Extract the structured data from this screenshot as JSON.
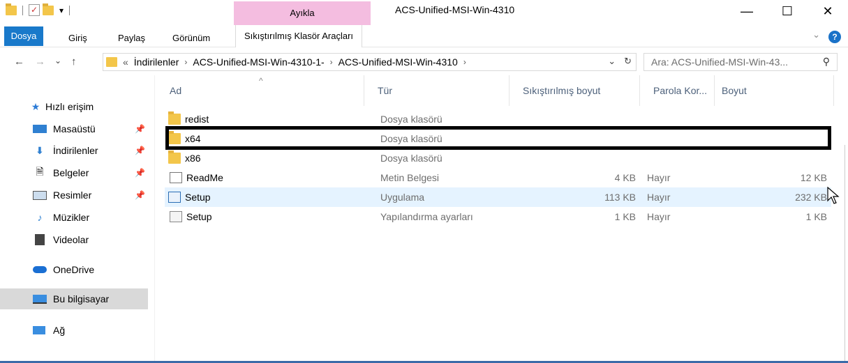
{
  "window": {
    "title": "ACS-Unified-MSI-Win-4310",
    "context_tab_header": "Ayıkla",
    "controls": {
      "minimize": "—",
      "maximize": "☐",
      "close": "✕"
    }
  },
  "ribbon": {
    "tabs": [
      {
        "label": "Dosya"
      },
      {
        "label": "Giriş"
      },
      {
        "label": "Paylaş"
      },
      {
        "label": "Görünüm"
      },
      {
        "label": "Sıkıştırılmış Klasör Araçları"
      }
    ],
    "help": "?",
    "expand": "⌄"
  },
  "nav": {
    "back": "←",
    "forward": "→",
    "recent": "⌄",
    "up": "↑",
    "breadcrumb": [
      "«",
      "İndirilenler",
      "ACS-Unified-MSI-Win-4310-1-",
      "ACS-Unified-MSI-Win-4310"
    ],
    "address_dropdown": "⌄",
    "refresh": "↻",
    "search_placeholder": "Ara: ACS-Unified-MSI-Win-43..."
  },
  "sidebar": {
    "items": [
      {
        "label": "Hızlı erişim",
        "icon": "star-icon"
      },
      {
        "label": "Masaüstü",
        "icon": "desktop-icon",
        "pinned": true
      },
      {
        "label": "İndirilenler",
        "icon": "download-icon",
        "pinned": true
      },
      {
        "label": "Belgeler",
        "icon": "documents-icon",
        "pinned": true
      },
      {
        "label": "Resimler",
        "icon": "pictures-icon",
        "pinned": true
      },
      {
        "label": "Müzikler",
        "icon": "music-icon"
      },
      {
        "label": "Videolar",
        "icon": "videos-icon"
      },
      {
        "label": "OneDrive",
        "icon": "cloud-icon"
      },
      {
        "label": "Bu bilgisayar",
        "icon": "computer-icon",
        "selected": true
      },
      {
        "label": "Ağ",
        "icon": "network-icon"
      }
    ]
  },
  "columns": [
    "Ad",
    "Tür",
    "Sıkıştırılmış boyut",
    "Parola Kor...",
    "Boyut"
  ],
  "files": [
    {
      "name": "redist",
      "type": "Dosya klasörü",
      "compressed": "",
      "password": "",
      "size": "",
      "icon": "folder"
    },
    {
      "name": "x64",
      "type": "Dosya klasörü",
      "compressed": "",
      "password": "",
      "size": "",
      "icon": "folder"
    },
    {
      "name": "x86",
      "type": "Dosya klasörü",
      "compressed": "",
      "password": "",
      "size": "",
      "icon": "folder"
    },
    {
      "name": "ReadMe",
      "type": "Metin Belgesi",
      "compressed": "4 KB",
      "password": "Hayır",
      "size": "12 KB",
      "icon": "doc"
    },
    {
      "name": "Setup",
      "type": "Uygulama",
      "compressed": "113 KB",
      "password": "Hayır",
      "size": "232 KB",
      "icon": "app"
    },
    {
      "name": "Setup",
      "type": "Yapılandırma ayarları",
      "compressed": "1 KB",
      "password": "Hayır",
      "size": "1 KB",
      "icon": "cfg"
    }
  ]
}
